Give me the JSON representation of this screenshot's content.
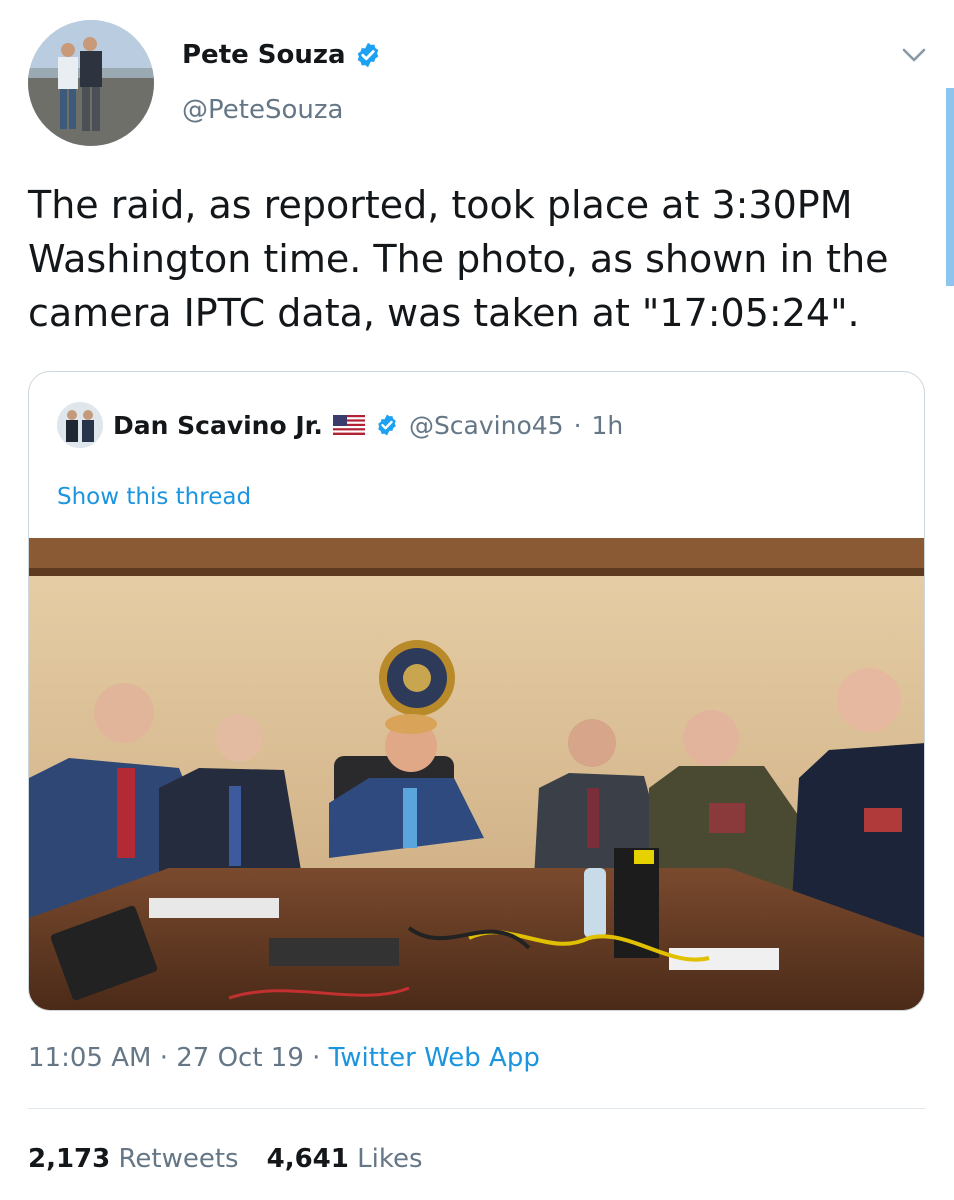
{
  "author": {
    "name": "Pete Souza",
    "handle": "@PeteSouza",
    "verified": true
  },
  "tweet": {
    "text_lines": [
      "The raid, as reported, took place at 3:30PM",
      "Washington time. The photo, as shown in the",
      "camera IPTC data, was taken at \"17:05:24\"."
    ]
  },
  "quoted_tweet": {
    "name": "Dan Scavino Jr.",
    "handle": "@Scavino45",
    "separator": "·",
    "time": "1h",
    "show_thread": "Show this thread",
    "photo_alt": "Situation room photo"
  },
  "meta": {
    "time": "11:05 AM",
    "dot1": "·",
    "date": "27 Oct 19",
    "dot2": "·",
    "source": "Twitter Web App"
  },
  "stats": {
    "retweets_count": "2,173",
    "retweets_label": "Retweets",
    "likes_count": "4,641",
    "likes_label": "Likes"
  },
  "colors": {
    "link_blue": "#1b95e0",
    "muted_gray": "#657786",
    "verified_blue": "#1da1f2",
    "text_dark": "#14171a"
  },
  "icons": {
    "verified": "verified-badge-icon",
    "chevron": "chevron-down-icon",
    "flag": "us-flag-icon"
  }
}
